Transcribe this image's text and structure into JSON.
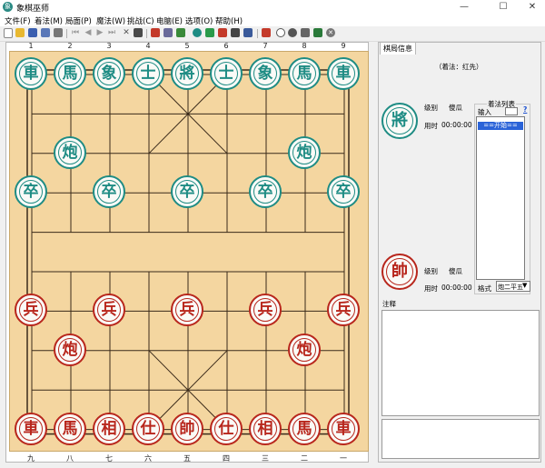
{
  "window": {
    "title": "象棋巫师",
    "app_icon_glyph": "象",
    "controls": [
      "—",
      "☐",
      "✕"
    ]
  },
  "menu": [
    "文件(F)",
    "着法(M)",
    "局面(P)",
    "魔法(W)",
    "挑战(C)",
    "电脑(E)",
    "选项(O)",
    "帮助(H)"
  ],
  "toolbar": {
    "icons": [
      "new-file-icon",
      "open-folder-icon",
      "save-icon",
      "save-as-icon",
      "print-icon",
      "first-move-icon",
      "prev-move-icon",
      "next-move-icon",
      "last-move-icon",
      "undo-icon",
      "copy-icon",
      "paste-icon",
      "book-icon",
      "edit-icon",
      "link-icon",
      "analyze-icon",
      "cut-icon",
      "timer-icon",
      "sound-icon",
      "settings-icon",
      "screen-icon",
      "stop-icon"
    ]
  },
  "board": {
    "top_file_labels": [
      "1",
      "2",
      "3",
      "4",
      "5",
      "6",
      "7",
      "8",
      "9"
    ],
    "bottom_file_labels": [
      "九",
      "八",
      "七",
      "六",
      "五",
      "四",
      "三",
      "二",
      "一"
    ],
    "colors": {
      "wood": "#f4d6a0",
      "black_side": "#1e8c84",
      "red_side": "#b8261c"
    },
    "black_pieces": [
      {
        "char": "車",
        "file": 0,
        "rank": 0
      },
      {
        "char": "馬",
        "file": 1,
        "rank": 0
      },
      {
        "char": "象",
        "file": 2,
        "rank": 0
      },
      {
        "char": "士",
        "file": 3,
        "rank": 0
      },
      {
        "char": "將",
        "file": 4,
        "rank": 0
      },
      {
        "char": "士",
        "file": 5,
        "rank": 0
      },
      {
        "char": "象",
        "file": 6,
        "rank": 0
      },
      {
        "char": "馬",
        "file": 7,
        "rank": 0
      },
      {
        "char": "車",
        "file": 8,
        "rank": 0
      },
      {
        "char": "炮",
        "file": 1,
        "rank": 2
      },
      {
        "char": "炮",
        "file": 7,
        "rank": 2
      },
      {
        "char": "卒",
        "file": 0,
        "rank": 3
      },
      {
        "char": "卒",
        "file": 2,
        "rank": 3
      },
      {
        "char": "卒",
        "file": 4,
        "rank": 3
      },
      {
        "char": "卒",
        "file": 6,
        "rank": 3
      },
      {
        "char": "卒",
        "file": 8,
        "rank": 3
      }
    ],
    "red_pieces": [
      {
        "char": "兵",
        "file": 0,
        "rank": 6
      },
      {
        "char": "兵",
        "file": 2,
        "rank": 6
      },
      {
        "char": "兵",
        "file": 4,
        "rank": 6
      },
      {
        "char": "兵",
        "file": 6,
        "rank": 6
      },
      {
        "char": "兵",
        "file": 8,
        "rank": 6
      },
      {
        "char": "炮",
        "file": 1,
        "rank": 7
      },
      {
        "char": "炮",
        "file": 7,
        "rank": 7
      },
      {
        "char": "車",
        "file": 0,
        "rank": 9
      },
      {
        "char": "馬",
        "file": 1,
        "rank": 9
      },
      {
        "char": "相",
        "file": 2,
        "rank": 9
      },
      {
        "char": "仕",
        "file": 3,
        "rank": 9
      },
      {
        "char": "帥",
        "file": 4,
        "rank": 9
      },
      {
        "char": "仕",
        "file": 5,
        "rank": 9
      },
      {
        "char": "相",
        "file": 6,
        "rank": 9
      },
      {
        "char": "馬",
        "file": 7,
        "rank": 9
      },
      {
        "char": "車",
        "file": 8,
        "rank": 9
      }
    ]
  },
  "side_panel": {
    "tab_label": "棋局信息",
    "first_move": "（着法：红先）",
    "black_player": {
      "piece": "將",
      "level_label": "级别",
      "level_value": "傻瓜",
      "time_label": "用时",
      "time_value": "00:00:00"
    },
    "red_player": {
      "piece": "帥",
      "level_label": "级别",
      "level_value": "傻瓜",
      "time_label": "用时",
      "time_value": "00:00:00"
    },
    "move_list": {
      "title": "着法列表",
      "input_label": "输入",
      "help": "?",
      "selected": "==开始=="
    },
    "format_label": "格式",
    "format_value": "炮二平五",
    "notes_label": "注释"
  }
}
